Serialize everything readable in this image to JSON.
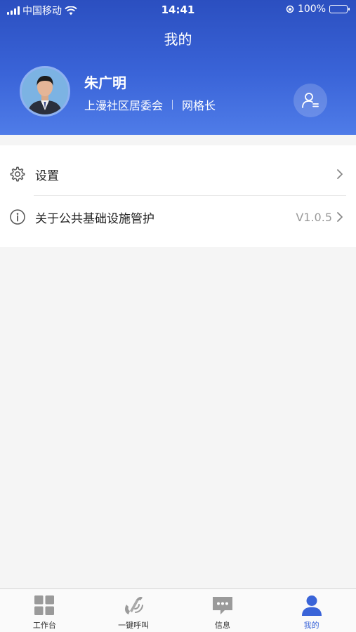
{
  "status_bar": {
    "carrier": "中国移动",
    "time": "14:41",
    "battery": "100%"
  },
  "header": {
    "title": "我的"
  },
  "profile": {
    "name": "朱广明",
    "organization": "上漫社区居委会",
    "role": "网格长"
  },
  "menu": {
    "items": [
      {
        "label": "设置",
        "icon": "gear-icon"
      },
      {
        "label": "关于公共基础设施管护",
        "icon": "info-icon",
        "version": "V1.0.5"
      }
    ]
  },
  "tabbar": {
    "tabs": [
      {
        "label": "工作台",
        "icon": "grid-icon"
      },
      {
        "label": "一键呼叫",
        "icon": "phone-icon"
      },
      {
        "label": "信息",
        "icon": "message-icon"
      },
      {
        "label": "我的",
        "icon": "user-icon",
        "active": true
      }
    ]
  },
  "colors": {
    "accent": "#3a64d8",
    "header_top": "#2b4fc0",
    "header_bottom": "#4f7ce8",
    "inactive_icon": "#9a9a9a"
  }
}
